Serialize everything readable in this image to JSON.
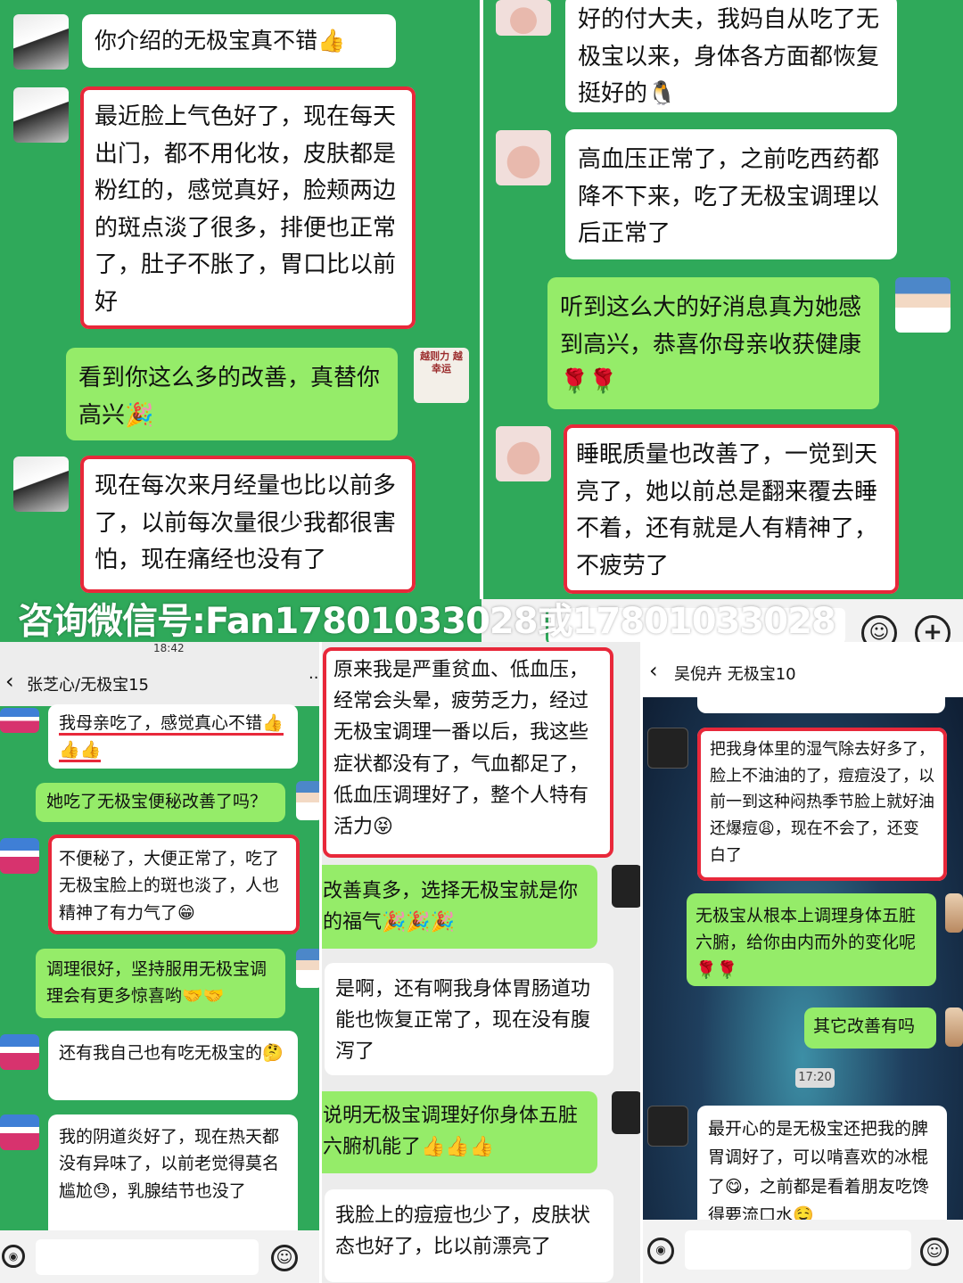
{
  "watermark": "咨询微信号:Fan17801033028或17801033028",
  "top_left": {
    "messages": [
      {
        "text": "你介绍的无极宝真不错👍"
      },
      {
        "text": "最近脸上气色好了，现在每天出门，都不用化妆，皮肤都是粉红的，感觉真好，脸颊两边的斑点淡了很多，排便也正常了，肚子不胀了，胃口比以前好"
      },
      {
        "text": "看到你这么多的改善，真替你高兴🎉"
      },
      {
        "text": "现在每次来月经量也比以前多了，以前每次量很少我都很害怕，现在痛经也没有了"
      }
    ],
    "avatar_text": "越则力 越幸运"
  },
  "top_right": {
    "messages": [
      {
        "text": "好的付大夫，我妈自从吃了无极宝以来，身体各方面都恢复挺好的🐧"
      },
      {
        "text": "高血压正常了，之前吃西药都降不下来，吃了无极宝调理以后正常了"
      },
      {
        "text": "听到这么大的好消息真为她感到高兴，恭喜你母亲收获健康🌹🌹"
      },
      {
        "text": "睡眠质量也改善了，一觉到天亮了，她以前总是翻来覆去睡不着，还有就是人有精神了，不疲劳了"
      }
    ]
  },
  "bottom_left": {
    "status_time": "18:42",
    "title": "张芝心/无极宝15",
    "messages": [
      {
        "text": "我母亲吃了，感觉真心不错👍👍👍"
      },
      {
        "text": "她吃了无极宝便秘改善了吗？"
      },
      {
        "text": "不便秘了，大便正常了，吃了无极宝脸上的斑也淡了，人也精神了有力气了😁"
      },
      {
        "text": "调理很好，坚持服用无极宝调理会有更多惊喜哟🤝🤝"
      },
      {
        "text": "还有我自己也有吃无极宝的🤔"
      },
      {
        "text": "我的阴道炎好了，现在热天都没有异味了，以前老觉得莫名尴尬😓，乳腺结节也没了"
      }
    ]
  },
  "bottom_middle": {
    "messages": [
      {
        "text": "原来我是严重贫血、低血压，经常会头晕，疲劳乏力，经过无极宝调理一番以后，我这些症状都没有了，气血都足了，低血压调理好了，整个人特有活力😝"
      },
      {
        "text": "改善真多，选择无极宝就是你的福气🎉🎉🎉"
      },
      {
        "text": "是啊，还有啊我身体胃肠道功能也恢复正常了，现在没有腹泻了"
      },
      {
        "text": "说明无极宝调理好你身体五脏六腑机能了👍👍👍"
      },
      {
        "text": "我脸上的痘痘也少了，皮肤状态也好了，比以前漂亮了"
      }
    ]
  },
  "bottom_right": {
    "title": "吴倪卉 无极宝10",
    "time_chip": "17:20",
    "messages": [
      {
        "text": "把我身体里的湿气除去好多了，脸上不油油的了，痘痘没了，以前一到这种闷热季节脸上就好油还爆痘😩，现在不会了，还变白了"
      },
      {
        "text": "无极宝从根本上调理身体五脏六腑，给你由内而外的变化呢🌹🌹"
      },
      {
        "text": "其它改善有吗"
      },
      {
        "text": "最开心的是无极宝还把我的脾胃调好了，可以啃喜欢的冰棍了😋，之前都是看着朋友吃馋得要流口水🤤"
      }
    ]
  },
  "icons": {
    "voice": "voice-icon",
    "emoji": "emoji-icon",
    "plus": "plus-icon",
    "back": "back-chevron-icon"
  },
  "colors": {
    "chat_green": "#2fa95a",
    "bubble_out": "#95ec69",
    "highlight_red": "#e8283a"
  }
}
